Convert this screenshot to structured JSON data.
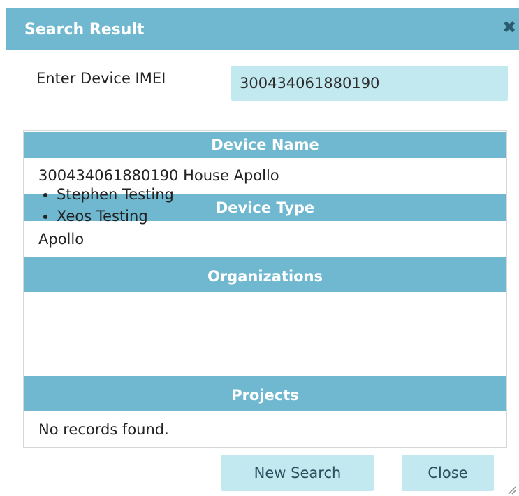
{
  "dialog": {
    "title": "Search Result",
    "close_icon": "close-icon"
  },
  "imei": {
    "label": "Enter Device IMEI",
    "value": "300434061880190"
  },
  "sections": {
    "device_name": {
      "header": "Device Name",
      "value": "300434061880190 House Apollo"
    },
    "device_type": {
      "header": "Device Type",
      "value": "Apollo"
    },
    "organizations": {
      "header": "Organizations",
      "items": [
        "Stephen Testing",
        "Xeos Testing"
      ]
    },
    "projects": {
      "header": "Projects",
      "value": "No records found."
    }
  },
  "buttons": {
    "new_search": "New Search",
    "close": "Close"
  },
  "colors": {
    "header_bg": "#6fb8cf",
    "input_bg": "#c2e8f0",
    "header_text": "#ffffff"
  }
}
